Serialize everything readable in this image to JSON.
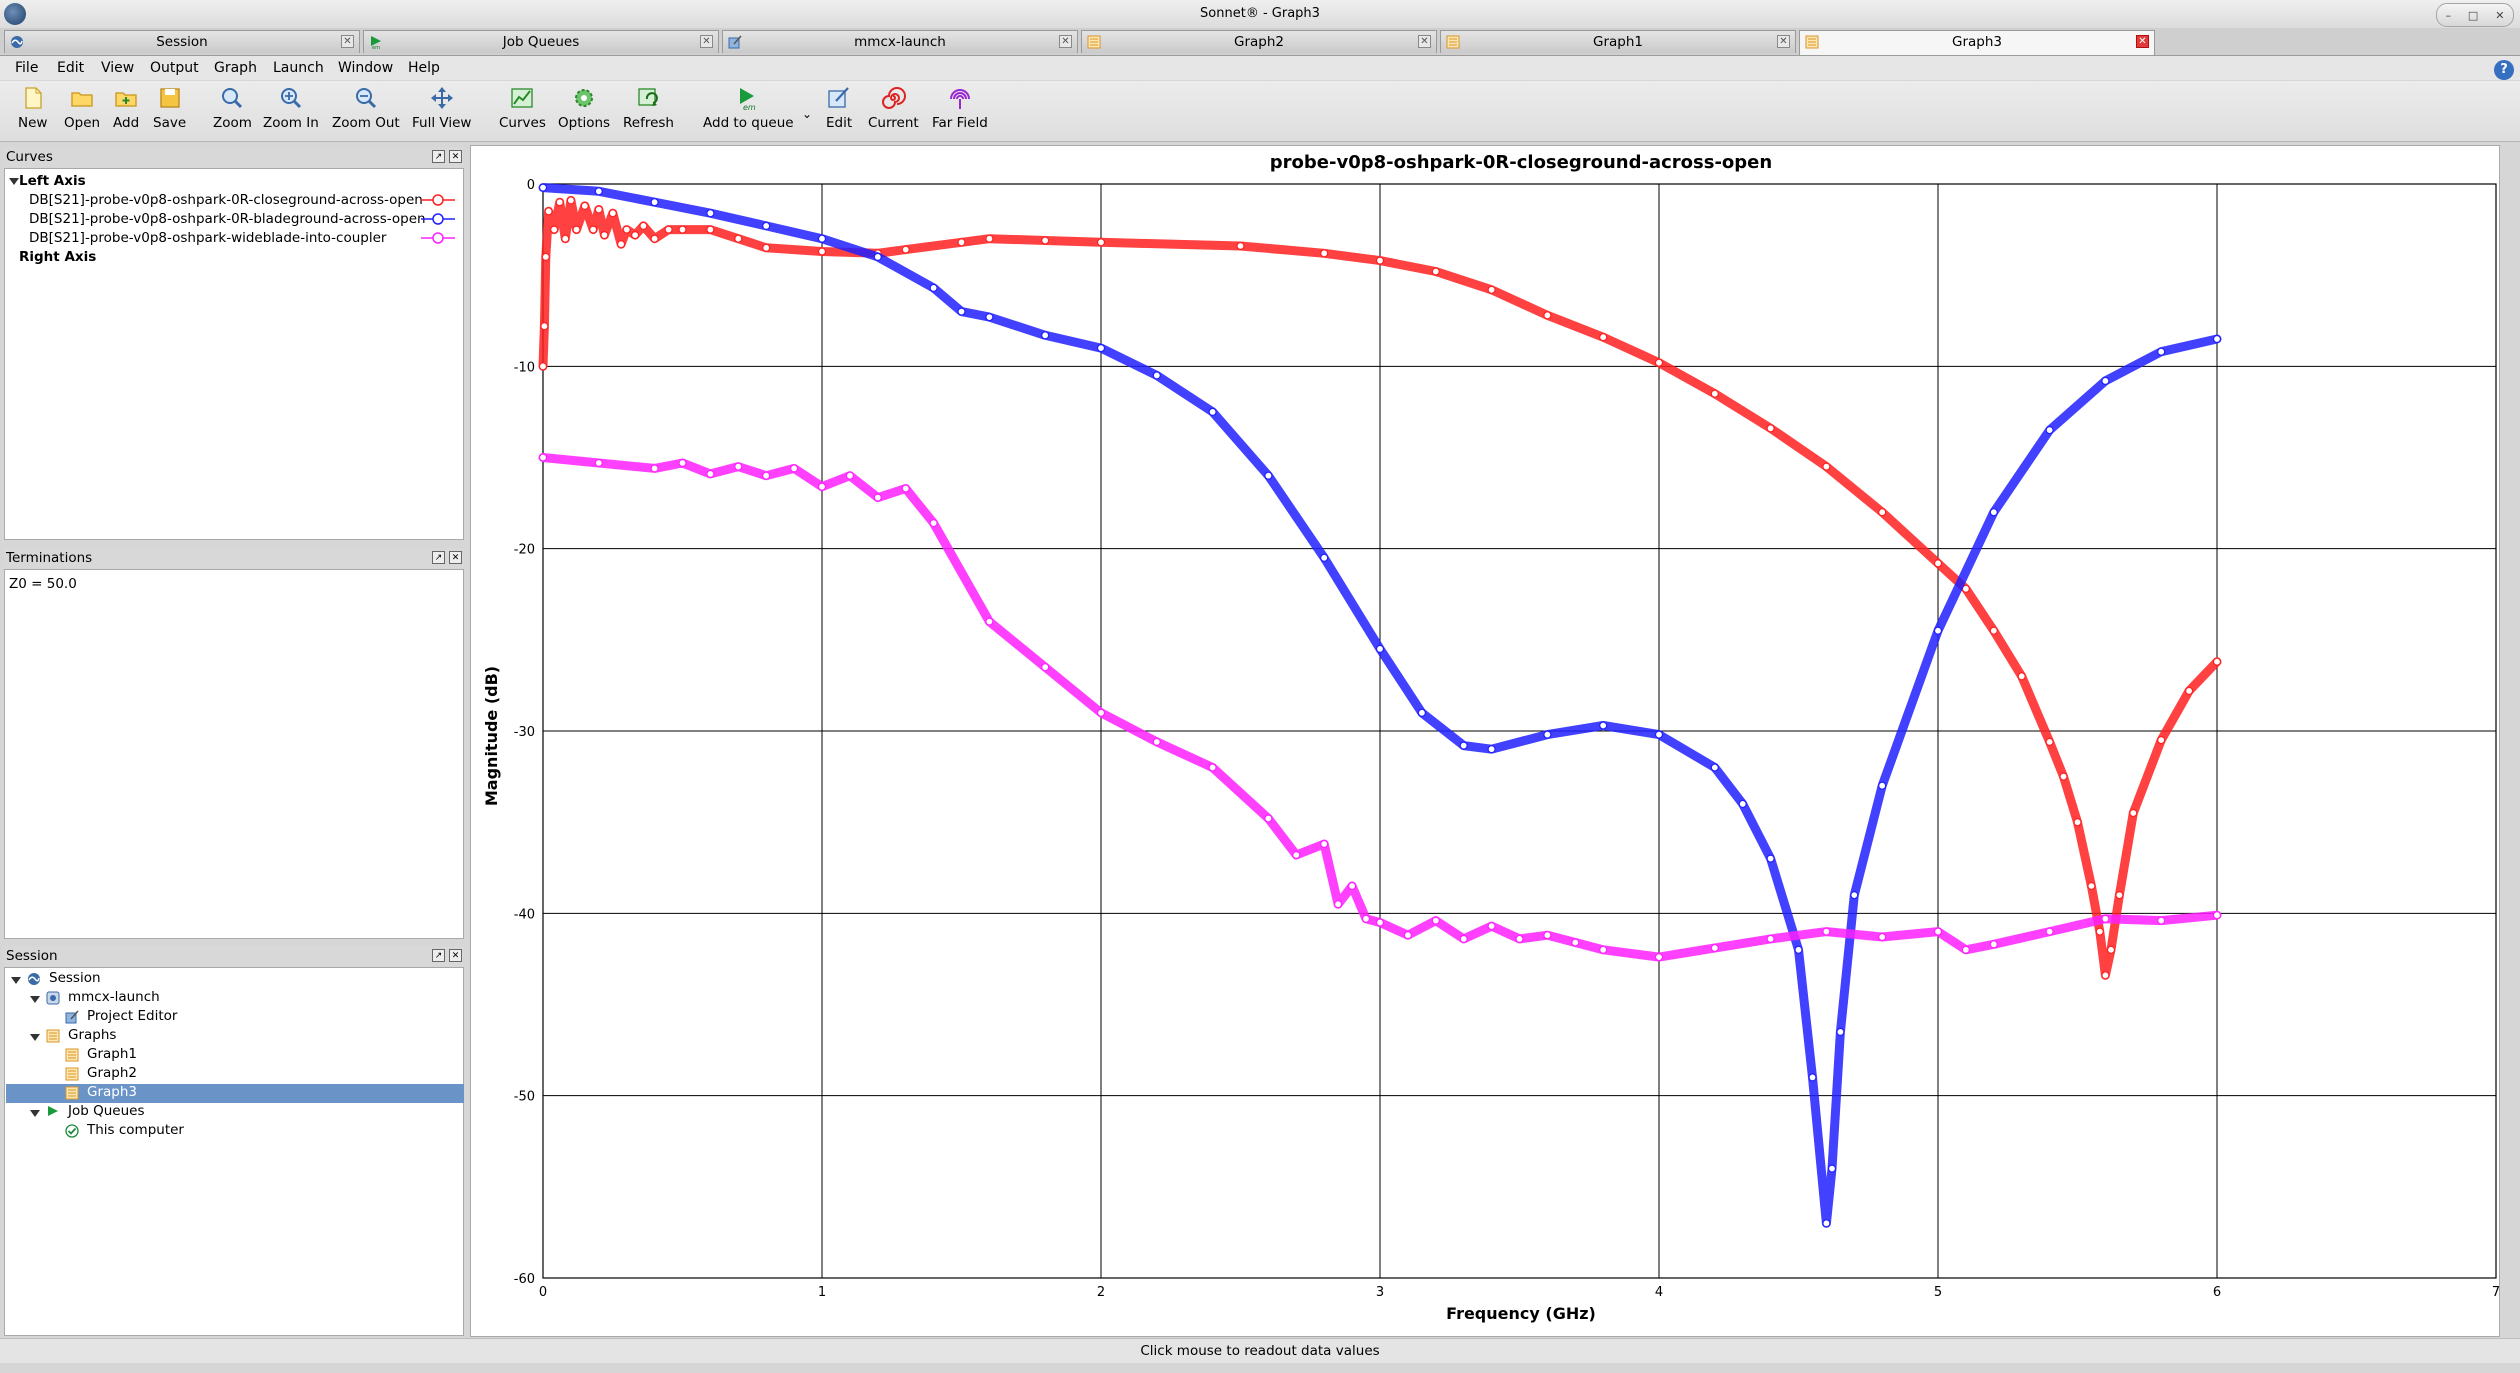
{
  "window": {
    "title": "Sonnet® - Graph3"
  },
  "tabs": [
    {
      "label": "Session",
      "icon": "sonnet-logo-icon",
      "active": false
    },
    {
      "label": "Job Queues",
      "icon": "job-queue-icon",
      "active": false
    },
    {
      "label": "mmcx-launch",
      "icon": "project-editor-icon",
      "active": false
    },
    {
      "label": "Graph2",
      "icon": "graph-icon",
      "active": false
    },
    {
      "label": "Graph1",
      "icon": "graph-icon",
      "active": false
    },
    {
      "label": "Graph3",
      "icon": "graph-icon",
      "active": true
    }
  ],
  "menu": [
    "File",
    "Edit",
    "View",
    "Output",
    "Graph",
    "Launch",
    "Window",
    "Help"
  ],
  "toolbar": [
    {
      "label": "New",
      "icon": "new-file-icon"
    },
    {
      "label": "Open",
      "icon": "open-folder-icon"
    },
    {
      "label": "Add",
      "icon": "add-folder-icon"
    },
    {
      "label": "Save",
      "icon": "save-icon"
    },
    {
      "label": "Zoom",
      "icon": "zoom-icon"
    },
    {
      "label": "Zoom In",
      "icon": "zoom-in-icon"
    },
    {
      "label": "Zoom Out",
      "icon": "zoom-out-icon"
    },
    {
      "label": "Full View",
      "icon": "full-view-icon"
    },
    {
      "label": "Curves",
      "icon": "curves-icon"
    },
    {
      "label": "Options",
      "icon": "options-gear-icon"
    },
    {
      "label": "Refresh",
      "icon": "refresh-icon"
    },
    {
      "label": "Add to queue",
      "icon": "add-to-queue-icon"
    },
    {
      "label": "Edit",
      "icon": "edit-icon"
    },
    {
      "label": "Current",
      "icon": "current-spiral-icon"
    },
    {
      "label": "Far Field",
      "icon": "far-field-icon"
    }
  ],
  "toolbar_icon_text": {
    "em": "em"
  },
  "curves_panel": {
    "title": "Curves",
    "left_axis_label": "Left Axis",
    "right_axis_label": "Right Axis",
    "items": [
      {
        "label": "DB[S21]-probe-v0p8-oshpark-0R-closeground-across-open",
        "color": "#ff2020"
      },
      {
        "label": "DB[S21]-probe-v0p8-oshpark-0R-bladeground-across-open",
        "color": "#2020ff"
      },
      {
        "label": "DB[S21]-probe-v0p8-oshpark-wideblade-into-coupler",
        "color": "#ff20ff"
      }
    ]
  },
  "terminations_panel": {
    "title": "Terminations",
    "value": "Z0 = 50.0"
  },
  "session_panel": {
    "title": "Session",
    "tree": [
      {
        "label": "Session",
        "level": 0,
        "icon": "sonnet-logo-icon",
        "expanded": true
      },
      {
        "label": "mmcx-launch",
        "level": 1,
        "icon": "project-icon",
        "expanded": true
      },
      {
        "label": "Project Editor",
        "level": 2,
        "icon": "project-editor-icon"
      },
      {
        "label": "Graphs",
        "level": 1,
        "icon": "graph-folder-icon",
        "expanded": true
      },
      {
        "label": "Graph1",
        "level": 2,
        "icon": "graph-icon"
      },
      {
        "label": "Graph2",
        "level": 2,
        "icon": "graph-icon"
      },
      {
        "label": "Graph3",
        "level": 2,
        "icon": "graph-icon",
        "selected": true
      },
      {
        "label": "Job Queues",
        "level": 1,
        "icon": "job-queue-icon",
        "expanded": true
      },
      {
        "label": "This computer",
        "level": 2,
        "icon": "checkmark-icon"
      }
    ]
  },
  "status": {
    "text": "Click mouse to readout data values"
  },
  "chart_data": {
    "type": "scatter",
    "title": "probe-v0p8-oshpark-0R-closeground-across-open",
    "xlabel": "Frequency (GHz)",
    "ylabel": "Magnitude (dB)",
    "xlim": [
      0,
      7
    ],
    "ylim": [
      -60,
      0
    ],
    "xticks": [
      0,
      1,
      2,
      3,
      4,
      5,
      6,
      7
    ],
    "yticks": [
      0,
      -10,
      -20,
      -30,
      -40,
      -50,
      -60
    ],
    "grid": true,
    "series": [
      {
        "name": "DB[S21]-probe-v0p8-oshpark-0R-closeground-across-open",
        "color": "#ff2020",
        "x": [
          0,
          0.005,
          0.01,
          0.02,
          0.04,
          0.06,
          0.08,
          0.1,
          0.12,
          0.15,
          0.18,
          0.2,
          0.22,
          0.25,
          0.28,
          0.3,
          0.33,
          0.36,
          0.4,
          0.45,
          0.5,
          0.6,
          0.7,
          0.8,
          1.0,
          1.2,
          1.3,
          1.5,
          1.6,
          1.8,
          2.0,
          2.5,
          2.8,
          3.0,
          3.2,
          3.4,
          3.6,
          3.8,
          4.0,
          4.2,
          4.4,
          4.6,
          4.8,
          5.0,
          5.1,
          5.2,
          5.3,
          5.4,
          5.45,
          5.5,
          5.55,
          5.58,
          5.6,
          5.62,
          5.65,
          5.7,
          5.8,
          5.9,
          6.0
        ],
        "y": [
          -10,
          -7.8,
          -4,
          -1.5,
          -2.5,
          -1,
          -3,
          -0.9,
          -2.5,
          -1.2,
          -2.5,
          -1.4,
          -2.8,
          -1.6,
          -3.3,
          -2.5,
          -2.8,
          -2.3,
          -3,
          -2.5,
          -2.5,
          -2.5,
          -3,
          -3.5,
          -3.7,
          -3.8,
          -3.6,
          -3.2,
          -3,
          -3.1,
          -3.2,
          -3.4,
          -3.8,
          -4.2,
          -4.8,
          -5.8,
          -7.2,
          -8.4,
          -9.8,
          -11.5,
          -13.4,
          -15.5,
          -18,
          -20.8,
          -22.2,
          -24.5,
          -27,
          -30.6,
          -32.5,
          -35,
          -38.5,
          -41,
          -43.4,
          -42,
          -39,
          -34.5,
          -30.5,
          -27.8,
          -26.2
        ]
      },
      {
        "name": "DB[S21]-probe-v0p8-oshpark-0R-bladeground-across-open",
        "color": "#2020ff",
        "x": [
          0,
          0.2,
          0.4,
          0.6,
          0.8,
          1.0,
          1.2,
          1.4,
          1.5,
          1.6,
          1.8,
          2.0,
          2.2,
          2.4,
          2.6,
          2.8,
          3.0,
          3.15,
          3.3,
          3.4,
          3.6,
          3.8,
          4.0,
          4.2,
          4.3,
          4.4,
          4.5,
          4.55,
          4.6,
          4.62,
          4.65,
          4.7,
          4.8,
          5.0,
          5.2,
          5.4,
          5.6,
          5.8,
          6.0
        ],
        "y": [
          -0.2,
          -0.4,
          -1,
          -1.6,
          -2.3,
          -3,
          -4,
          -5.7,
          -7,
          -7.3,
          -8.3,
          -9,
          -10.5,
          -12.5,
          -16,
          -20.5,
          -25.5,
          -29,
          -30.8,
          -31,
          -30.2,
          -29.7,
          -30.2,
          -32,
          -34,
          -37,
          -42,
          -49,
          -57,
          -54,
          -46.5,
          -39,
          -33,
          -24.5,
          -18,
          -13.5,
          -10.8,
          -9.2,
          -8.5
        ]
      },
      {
        "name": "DB[S21]-probe-v0p8-oshpark-wideblade-into-coupler",
        "color": "#ff20ff",
        "x": [
          0,
          0.2,
          0.4,
          0.5,
          0.6,
          0.7,
          0.8,
          0.9,
          1.0,
          1.1,
          1.2,
          1.3,
          1.4,
          1.6,
          1.8,
          2.0,
          2.2,
          2.4,
          2.6,
          2.7,
          2.8,
          2.85,
          2.9,
          2.95,
          3.0,
          3.1,
          3.2,
          3.3,
          3.4,
          3.5,
          3.6,
          3.7,
          3.8,
          4.0,
          4.2,
          4.4,
          4.6,
          4.8,
          5.0,
          5.1,
          5.2,
          5.4,
          5.6,
          5.8,
          6.0
        ],
        "y": [
          -15,
          -15.3,
          -15.6,
          -15.3,
          -15.9,
          -15.5,
          -16.0,
          -15.6,
          -16.6,
          -16.0,
          -17.2,
          -16.7,
          -18.6,
          -24,
          -26.5,
          -29,
          -30.6,
          -32,
          -34.8,
          -36.8,
          -36.2,
          -39.5,
          -38.5,
          -40.3,
          -40.5,
          -41.2,
          -40.4,
          -41.4,
          -40.7,
          -41.4,
          -41.2,
          -41.6,
          -42,
          -42.4,
          -41.9,
          -41.4,
          -41,
          -41.3,
          -41,
          -42,
          -41.7,
          -41,
          -40.3,
          -40.4,
          -40.1
        ]
      }
    ]
  }
}
